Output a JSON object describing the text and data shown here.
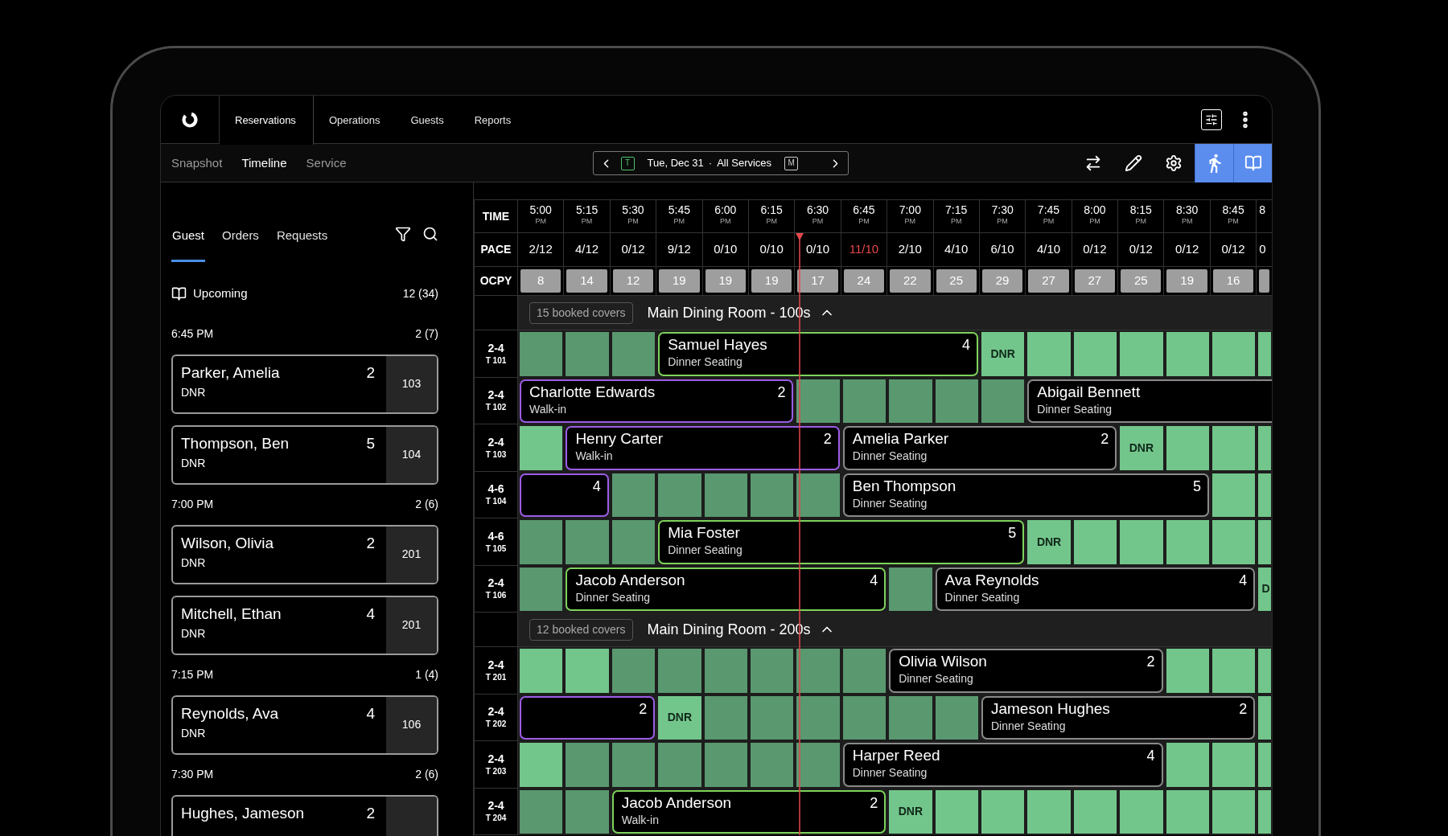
{
  "nav": {
    "tabs": [
      {
        "label": "Reservations",
        "selected": true
      },
      {
        "label": "Operations",
        "selected": false
      },
      {
        "label": "Guests",
        "selected": false
      },
      {
        "label": "Reports",
        "selected": false
      }
    ]
  },
  "subnav": {
    "views": [
      {
        "label": "Snapshot",
        "selected": false
      },
      {
        "label": "Timeline",
        "selected": true
      },
      {
        "label": "Service",
        "selected": false
      }
    ]
  },
  "date_picker": {
    "today_key": "T",
    "date": "Tue, Dec 31",
    "separator": "·",
    "service": "All Services",
    "month_key": "M"
  },
  "toolbar": [
    {
      "kind": "swap",
      "on": false
    },
    {
      "kind": "edit",
      "on": false
    },
    {
      "kind": "settings",
      "on": false
    },
    {
      "kind": "walk",
      "on": true
    },
    {
      "kind": "book",
      "on": true
    }
  ],
  "sidebar": {
    "tabs": [
      {
        "label": "Guest",
        "selected": true
      },
      {
        "label": "Orders",
        "selected": false
      },
      {
        "label": "Requests",
        "selected": false
      }
    ],
    "upcoming": {
      "label": "Upcoming",
      "count": "12 (34)"
    },
    "groups": [
      {
        "time": "6:45 PM",
        "count": "2 (7)",
        "cards": [
          {
            "name": "Parker, Amelia",
            "covers": "2",
            "note": "DNR",
            "table": "103"
          },
          {
            "name": "Thompson, Ben",
            "covers": "5",
            "note": "DNR",
            "table": "104"
          }
        ]
      },
      {
        "time": "7:00 PM",
        "count": "2 (6)",
        "cards": [
          {
            "name": "Wilson, Olivia",
            "covers": "2",
            "note": "DNR",
            "table": "201"
          },
          {
            "name": "Mitchell, Ethan",
            "covers": "4",
            "note": "DNR",
            "table": "201"
          }
        ]
      },
      {
        "time": "7:15 PM",
        "count": "1 (4)",
        "cards": [
          {
            "name": "Reynolds, Ava",
            "covers": "4",
            "note": "DNR",
            "table": "106"
          }
        ]
      },
      {
        "time": "7:30 PM",
        "count": "2 (6)",
        "cards": [
          {
            "name": "Hughes, Jameson",
            "covers": "2"
          }
        ]
      }
    ]
  },
  "timeline": {
    "labels": {
      "time": "TIME",
      "pace": "PACE",
      "occupancy": "OCPY"
    },
    "columns": [
      {
        "time": "5:00",
        "meridiem": "PM",
        "pace": "2/12",
        "over": false,
        "occupancy": "8",
        "current": false
      },
      {
        "time": "5:15",
        "meridiem": "PM",
        "pace": "4/12",
        "over": false,
        "occupancy": "14",
        "current": false
      },
      {
        "time": "5:30",
        "meridiem": "PM",
        "pace": "0/12",
        "over": false,
        "occupancy": "12",
        "current": false
      },
      {
        "time": "5:45",
        "meridiem": "PM",
        "pace": "9/12",
        "over": false,
        "occupancy": "19",
        "current": false
      },
      {
        "time": "6:00",
        "meridiem": "PM",
        "pace": "0/10",
        "over": false,
        "occupancy": "19",
        "current": false
      },
      {
        "time": "6:15",
        "meridiem": "PM",
        "pace": "0/10",
        "over": false,
        "occupancy": "19",
        "current": false
      },
      {
        "time": "6:30",
        "meridiem": "PM",
        "pace": "0/10",
        "over": false,
        "occupancy": "17",
        "current": true
      },
      {
        "time": "6:45",
        "meridiem": "PM",
        "pace": "11/10",
        "over": true,
        "occupancy": "24",
        "current": false
      },
      {
        "time": "7:00",
        "meridiem": "PM",
        "pace": "2/10",
        "over": false,
        "occupancy": "22",
        "current": false
      },
      {
        "time": "7:15",
        "meridiem": "PM",
        "pace": "4/10",
        "over": false,
        "occupancy": "25",
        "current": false
      },
      {
        "time": "7:30",
        "meridiem": "PM",
        "pace": "6/10",
        "over": false,
        "occupancy": "29",
        "current": false
      },
      {
        "time": "7:45",
        "meridiem": "PM",
        "pace": "4/10",
        "over": false,
        "occupancy": "27",
        "current": false
      },
      {
        "time": "8:00",
        "meridiem": "PM",
        "pace": "0/12",
        "over": false,
        "occupancy": "27",
        "current": false
      },
      {
        "time": "8:15",
        "meridiem": "PM",
        "pace": "0/12",
        "over": false,
        "occupancy": "25",
        "current": false
      },
      {
        "time": "8:30",
        "meridiem": "PM",
        "pace": "0/12",
        "over": false,
        "occupancy": "19",
        "current": false
      },
      {
        "time": "8:45",
        "meridiem": "PM",
        "pace": "0/12",
        "over": false,
        "occupancy": "16",
        "current": false
      },
      {
        "time": "8",
        "pace": "0",
        "over": false,
        "current": false
      }
    ],
    "sections": [
      {
        "covers": "15 booked covers",
        "title": "Main Dining Room - 100s",
        "expanded": true,
        "tables": [
          {
            "size": "2-4",
            "table": "T 101",
            "slots": [
              {
                "kind": "closed"
              },
              {
                "kind": "closed"
              },
              {
                "kind": "closed"
              },
              {
                "kind": "booking",
                "name": "Samuel Hayes",
                "type": "Dinner Seating",
                "covers": "4",
                "color": "#7dd35b"
              },
              {
                "kind": "cont"
              },
              {
                "kind": "cont"
              },
              {
                "kind": "cont"
              },
              {
                "kind": "cont"
              },
              {
                "kind": "cont"
              },
              {
                "kind": "cont"
              },
              {
                "kind": "dnr",
                "label": "DNR"
              },
              {
                "kind": "open"
              },
              {
                "kind": "open"
              },
              {
                "kind": "open"
              },
              {
                "kind": "open"
              },
              {
                "kind": "open"
              },
              {
                "kind": "open"
              }
            ]
          },
          {
            "size": "2-4",
            "table": "T 102",
            "slots": [
              {
                "kind": "booking",
                "name": "Charlotte Edwards",
                "type": "Walk-in",
                "covers": "2",
                "color": "#9d5ce6"
              },
              {
                "kind": "cont"
              },
              {
                "kind": "cont"
              },
              {
                "kind": "cont"
              },
              {
                "kind": "cont"
              },
              {
                "kind": "cont"
              },
              {
                "kind": "closed"
              },
              {
                "kind": "closed"
              },
              {
                "kind": "closed"
              },
              {
                "kind": "closed"
              },
              {
                "kind": "closed"
              },
              {
                "kind": "booking",
                "name": "Abigail Bennett",
                "type": "Dinner Seating",
                "color": "#8a8a8a"
              },
              {
                "kind": "cont"
              },
              {
                "kind": "cont"
              },
              {
                "kind": "cont"
              },
              {
                "kind": "cont"
              },
              {
                "kind": "cont"
              }
            ]
          },
          {
            "size": "2-4",
            "table": "T 103",
            "slots": [
              {
                "kind": "open"
              },
              {
                "kind": "booking",
                "name": "Henry Carter",
                "type": "Walk-in",
                "covers": "2",
                "color": "#9d5ce6"
              },
              {
                "kind": "cont"
              },
              {
                "kind": "cont"
              },
              {
                "kind": "cont"
              },
              {
                "kind": "cont"
              },
              {
                "kind": "cont"
              },
              {
                "kind": "booking",
                "name": "Amelia Parker",
                "type": "Dinner Seating",
                "covers": "2",
                "color": "#8a8a8a"
              },
              {
                "kind": "cont"
              },
              {
                "kind": "cont"
              },
              {
                "kind": "cont"
              },
              {
                "kind": "cont"
              },
              {
                "kind": "cont"
              },
              {
                "kind": "dnr",
                "label": "DNR"
              },
              {
                "kind": "open"
              },
              {
                "kind": "open"
              },
              {
                "kind": "open"
              }
            ]
          },
          {
            "size": "4-6",
            "table": "T 104",
            "slots": [
              {
                "kind": "booking",
                "covers": "4",
                "color": "#9d5ce6"
              },
              {
                "kind": "cont"
              },
              {
                "kind": "closed"
              },
              {
                "kind": "closed"
              },
              {
                "kind": "closed"
              },
              {
                "kind": "closed"
              },
              {
                "kind": "closed"
              },
              {
                "kind": "booking",
                "name": "Ben Thompson",
                "type": "Dinner Seating",
                "covers": "5",
                "color": "#8a8a8a"
              },
              {
                "kind": "cont"
              },
              {
                "kind": "cont"
              },
              {
                "kind": "cont"
              },
              {
                "kind": "cont"
              },
              {
                "kind": "cont"
              },
              {
                "kind": "cont"
              },
              {
                "kind": "cont"
              },
              {
                "kind": "open"
              },
              {
                "kind": "open"
              }
            ]
          },
          {
            "size": "4-6",
            "table": "T 105",
            "slots": [
              {
                "kind": "closed"
              },
              {
                "kind": "closed"
              },
              {
                "kind": "closed"
              },
              {
                "kind": "booking",
                "name": "Mia Foster",
                "type": "Dinner Seating",
                "covers": "5",
                "color": "#7dd35b"
              },
              {
                "kind": "cont"
              },
              {
                "kind": "cont"
              },
              {
                "kind": "cont"
              },
              {
                "kind": "cont"
              },
              {
                "kind": "cont"
              },
              {
                "kind": "cont"
              },
              {
                "kind": "cont"
              },
              {
                "kind": "dnr",
                "label": "DNR"
              },
              {
                "kind": "open"
              },
              {
                "kind": "open"
              },
              {
                "kind": "open"
              },
              {
                "kind": "open"
              },
              {
                "kind": "open"
              }
            ]
          },
          {
            "size": "2-4",
            "table": "T 106",
            "slots": [
              {
                "kind": "closed"
              },
              {
                "kind": "booking",
                "name": "Jacob Anderson",
                "type": "Dinner Seating",
                "covers": "4",
                "color": "#7dd35b"
              },
              {
                "kind": "cont"
              },
              {
                "kind": "cont"
              },
              {
                "kind": "cont"
              },
              {
                "kind": "cont"
              },
              {
                "kind": "cont"
              },
              {
                "kind": "cont"
              },
              {
                "kind": "closed"
              },
              {
                "kind": "booking",
                "name": "Ava Reynolds",
                "type": "Dinner Seating",
                "covers": "4",
                "color": "#8a8a8a"
              },
              {
                "kind": "cont"
              },
              {
                "kind": "cont"
              },
              {
                "kind": "cont"
              },
              {
                "kind": "cont"
              },
              {
                "kind": "cont"
              },
              {
                "kind": "cont"
              },
              {
                "kind": "dnr",
                "label": "D"
              }
            ]
          }
        ]
      },
      {
        "covers": "12 booked covers",
        "title": "Main Dining Room - 200s",
        "expanded": true,
        "tables": [
          {
            "size": "2-4",
            "table": "T 201",
            "slots": [
              {
                "kind": "open"
              },
              {
                "kind": "open"
              },
              {
                "kind": "closed"
              },
              {
                "kind": "closed"
              },
              {
                "kind": "closed"
              },
              {
                "kind": "closed"
              },
              {
                "kind": "closed"
              },
              {
                "kind": "closed"
              },
              {
                "kind": "booking",
                "name": "Olivia Wilson",
                "type": "Dinner Seating",
                "covers": "2",
                "color": "#8a8a8a"
              },
              {
                "kind": "cont"
              },
              {
                "kind": "cont"
              },
              {
                "kind": "cont"
              },
              {
                "kind": "cont"
              },
              {
                "kind": "cont"
              },
              {
                "kind": "open"
              },
              {
                "kind": "open"
              },
              {
                "kind": "open"
              }
            ]
          },
          {
            "size": "2-4",
            "table": "T 202",
            "slots": [
              {
                "kind": "booking",
                "covers": "2",
                "color": "#9d5ce6"
              },
              {
                "kind": "cont"
              },
              {
                "kind": "cont"
              },
              {
                "kind": "dnr",
                "label": "DNR"
              },
              {
                "kind": "closed"
              },
              {
                "kind": "closed"
              },
              {
                "kind": "closed"
              },
              {
                "kind": "closed"
              },
              {
                "kind": "closed"
              },
              {
                "kind": "closed"
              },
              {
                "kind": "booking",
                "name": "Jameson Hughes",
                "type": "Dinner Seating",
                "covers": "2",
                "color": "#8a8a8a"
              },
              {
                "kind": "cont"
              },
              {
                "kind": "cont"
              },
              {
                "kind": "cont"
              },
              {
                "kind": "cont"
              },
              {
                "kind": "cont"
              },
              {
                "kind": "open"
              }
            ]
          },
          {
            "size": "2-4",
            "table": "T 203",
            "slots": [
              {
                "kind": "open"
              },
              {
                "kind": "closed"
              },
              {
                "kind": "closed"
              },
              {
                "kind": "closed"
              },
              {
                "kind": "closed"
              },
              {
                "kind": "closed"
              },
              {
                "kind": "closed"
              },
              {
                "kind": "booking",
                "name": "Harper Reed",
                "type": "Dinner Seating",
                "covers": "4",
                "color": "#8a8a8a"
              },
              {
                "kind": "cont"
              },
              {
                "kind": "cont"
              },
              {
                "kind": "cont"
              },
              {
                "kind": "cont"
              },
              {
                "kind": "cont"
              },
              {
                "kind": "cont"
              },
              {
                "kind": "open"
              },
              {
                "kind": "open"
              },
              {
                "kind": "open"
              }
            ]
          },
          {
            "size": "2-4",
            "table": "T 204",
            "slots": [
              {
                "kind": "closed"
              },
              {
                "kind": "closed"
              },
              {
                "kind": "booking",
                "name": "Jacob Anderson",
                "type": "Walk-in",
                "covers": "2",
                "color": "#7dd35b"
              },
              {
                "kind": "cont"
              },
              {
                "kind": "cont"
              },
              {
                "kind": "cont"
              },
              {
                "kind": "cont"
              },
              {
                "kind": "cont"
              },
              {
                "kind": "dnr",
                "label": "DNR"
              },
              {
                "kind": "open"
              },
              {
                "kind": "open"
              },
              {
                "kind": "open"
              },
              {
                "kind": "open"
              },
              {
                "kind": "open"
              },
              {
                "kind": "open"
              },
              {
                "kind": "open"
              },
              {
                "kind": "open"
              }
            ]
          }
        ]
      }
    ]
  }
}
